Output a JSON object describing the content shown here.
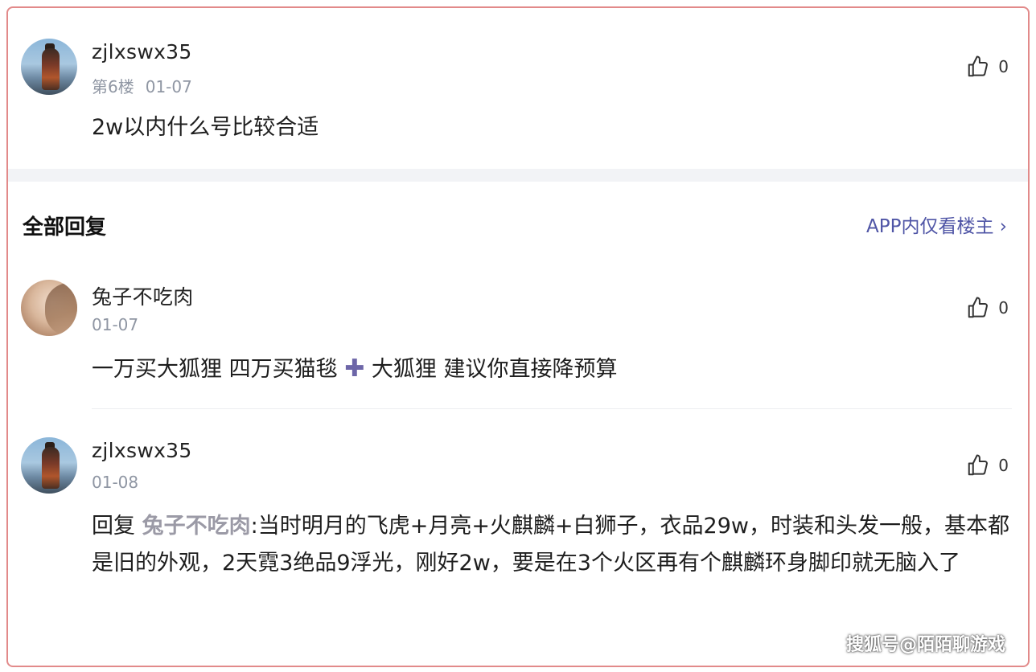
{
  "post": {
    "username": "zjlxswx35",
    "floor": "第6楼",
    "date": "01-07",
    "likes": "0",
    "text": "2w以内什么号比较合适"
  },
  "section": {
    "title": "全部回复",
    "app_link": "APP内仅看楼主 ›"
  },
  "replies": [
    {
      "username": "兔子不吃肉",
      "date": "01-07",
      "likes": "0",
      "text_a": "一万买大狐狸 四万买猫毯",
      "plus": "✚",
      "text_b": "大狐狸 建议你直接降预算"
    },
    {
      "username": "zjlxswx35",
      "date": "01-08",
      "likes": "0",
      "reply_word": "回复",
      "mention": "兔子不吃肉",
      "text": ":当时明月的飞虎+月亮+火麒麟+白狮子，衣品29w，时装和头发一般，基本都是旧的外观，2天霓3绝品9浮光，刚好2w，要是在3个火区再有个麒麟环身脚印就无脑入了"
    }
  ],
  "watermark": "搜狐号@陌陌聊游戏",
  "colors": {
    "border": "#e28a8a",
    "link": "#4f55a6",
    "meta": "#8f96a3"
  }
}
